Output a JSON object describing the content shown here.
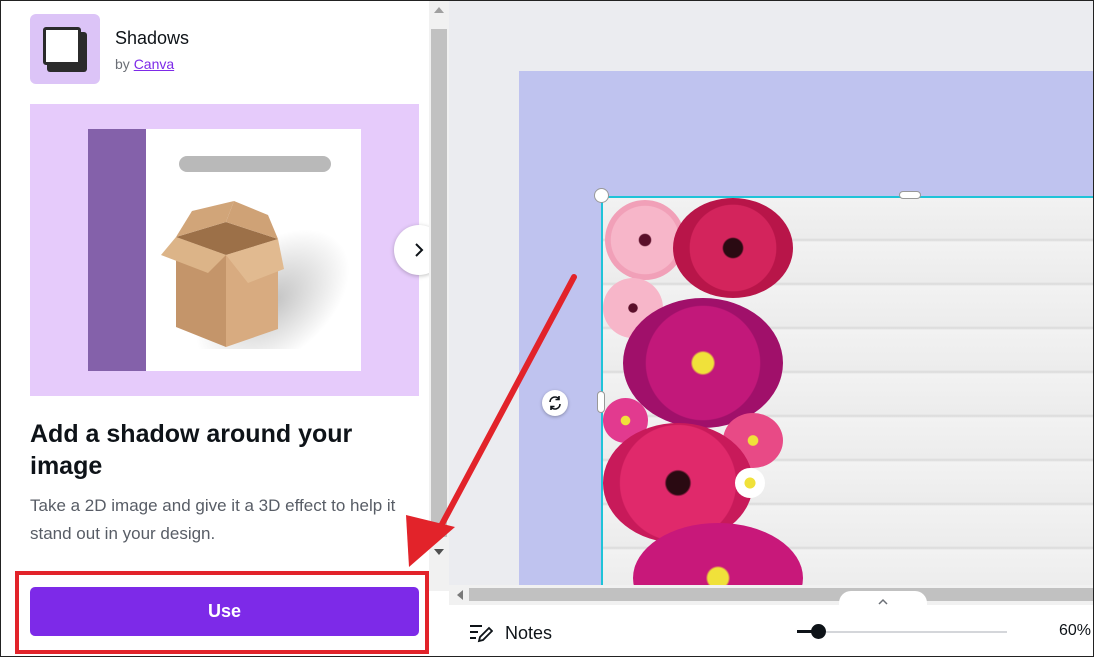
{
  "app": {
    "name": "Shadows",
    "by_prefix": "by",
    "by_link": "Canva"
  },
  "content": {
    "heading": "Add a shadow around your image",
    "description": "Take a 2D image and give it a 3D effect to help it stand out in your design."
  },
  "actions": {
    "use_label": "Use"
  },
  "footer": {
    "notes_label": "Notes",
    "zoom_value": "60%",
    "zoom_level": 0.1
  },
  "colors": {
    "accent": "#7d2ae8",
    "highlight": "#e2232a",
    "selection": "#1fc3d8",
    "artboard": "#bfc3ef"
  },
  "icons": [
    "chevron-right-icon",
    "rotate-icon",
    "notes-icon",
    "chevron-up-icon"
  ]
}
